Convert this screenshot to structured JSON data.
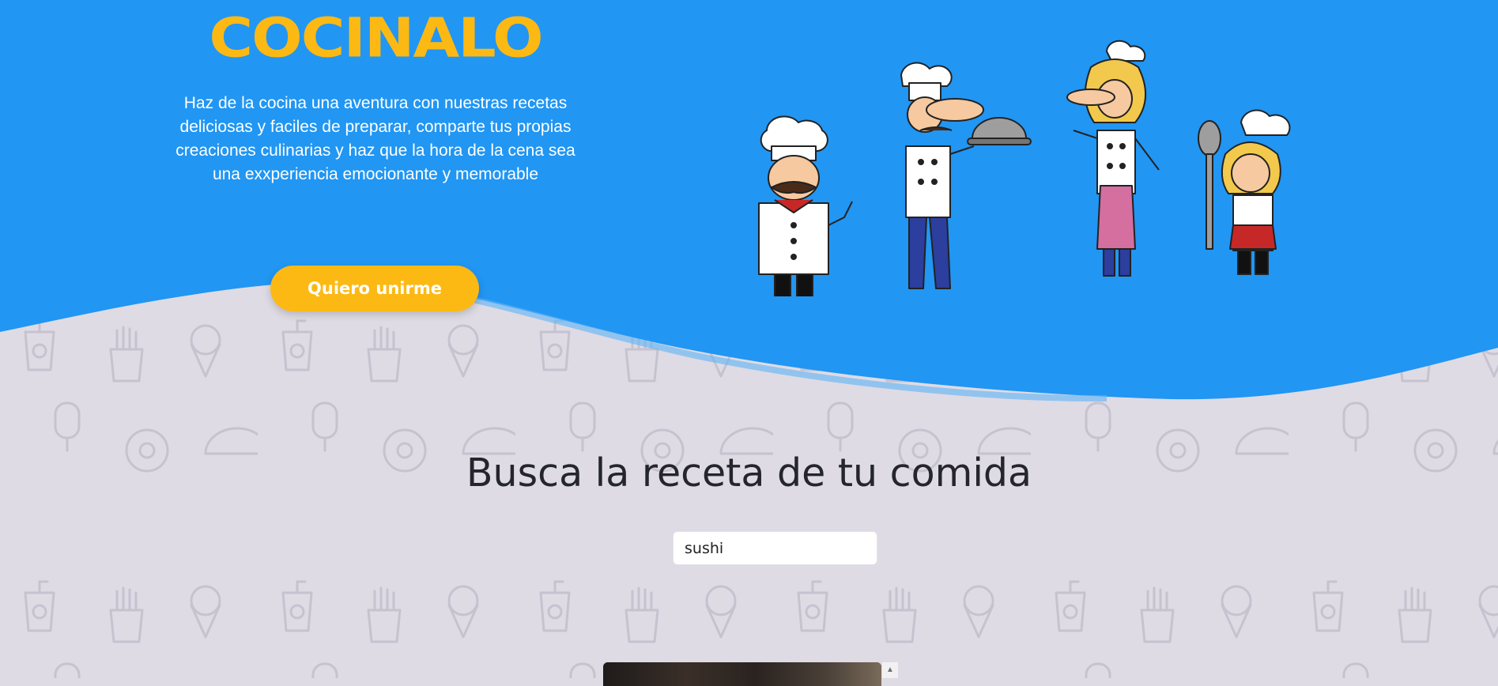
{
  "hero": {
    "brand": "COCINALO",
    "tagline": "Haz de la cocina una aventura con nuestras recetas deliciosas y faciles de preparar, comparte tus propias creaciones culinarias y haz que la hora de la cena sea una exxperiencia emocionante y memorable",
    "join_button": "Quiero unirme"
  },
  "search": {
    "title": "Busca la receta de tu comida",
    "value": "sushi"
  },
  "colors": {
    "hero_blue": "#2196f3",
    "accent_yellow": "#fdb913",
    "pattern_bg": "#dedbe4"
  },
  "icons": {
    "scroll_up": "▲"
  }
}
